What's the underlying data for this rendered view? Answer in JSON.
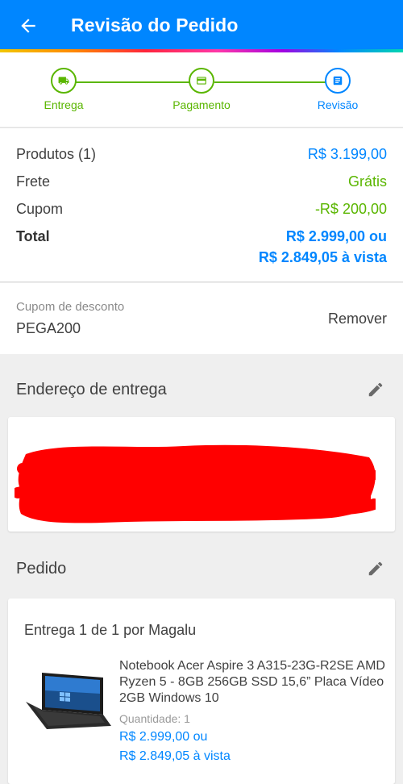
{
  "header": {
    "title": "Revisão do Pedido",
    "back_icon": "arrow-left-icon",
    "background": "#0086ff"
  },
  "stepper": {
    "steps": [
      {
        "label": "Entrega",
        "icon": "truck-icon",
        "state": "done"
      },
      {
        "label": "Pagamento",
        "icon": "credit-card-icon",
        "state": "done"
      },
      {
        "label": "Revisão",
        "icon": "list-icon",
        "state": "active"
      }
    ],
    "done_color": "#5ab600",
    "active_color": "#0086ff"
  },
  "summary": {
    "products_label": "Produtos (1)",
    "products_value": "R$ 3.199,00",
    "shipping_label": "Frete",
    "shipping_value": "Grátis",
    "coupon_label": "Cupom",
    "coupon_value": "-R$ 200,00",
    "total_label": "Total",
    "total_value": "R$ 2.999,00 ou",
    "total_cash_value": "R$ 2.849,05 à vista"
  },
  "coupon": {
    "hint": "Cupom de desconto",
    "code": "PEGA200",
    "remove_label": "Remover"
  },
  "address": {
    "title": "Endereço de entrega",
    "edit_icon": "pencil-icon",
    "redaction_color": "#ff0000"
  },
  "order": {
    "title": "Pedido",
    "edit_icon": "pencil-icon",
    "delivery_title": "Entrega 1 de 1 por Magalu",
    "product": {
      "name": "Notebook Acer Aspire 3 A315-23G-R2SE AMD Ryzen 5 - 8GB 256GB SSD 15,6” Placa Vídeo 2GB Windows 10",
      "quantity": "Quantidade:  1",
      "price": "R$ 2.999,00 ou",
      "price_cash": "R$ 2.849,05 à vista",
      "image_icon": "laptop-icon"
    }
  }
}
